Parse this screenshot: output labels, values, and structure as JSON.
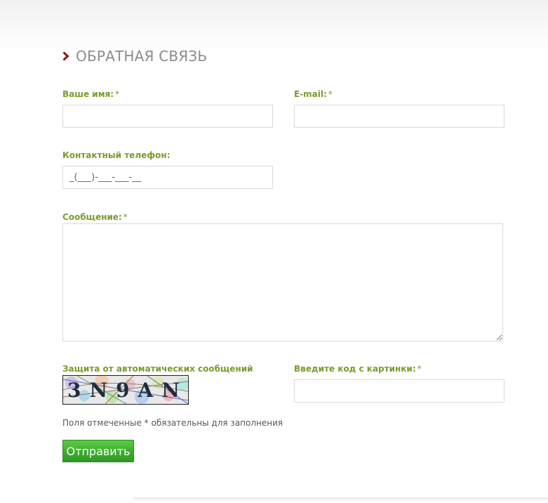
{
  "page": {
    "title": "ОБРАТНАЯ СВЯЗЬ",
    "accent_color": "#8b1a1a",
    "label_color": "#7a9b2c"
  },
  "form": {
    "name": {
      "label": "Ваше имя:",
      "required_mark": "*",
      "value": ""
    },
    "email": {
      "label": "E-mail:",
      "required_mark": "*",
      "value": ""
    },
    "phone": {
      "label": "Контактный телефон:",
      "placeholder": "_(___)-___-___-__"
    },
    "message": {
      "label": "Сообщение:",
      "required_mark": "*",
      "value": ""
    },
    "captcha": {
      "label": "Защита от автоматических сообщений",
      "image_text": "3N9AN"
    },
    "captcha_code": {
      "label": "Введите код с картинки:",
      "required_mark": "*",
      "value": ""
    },
    "required_note": "Поля отмеченные * обязательны для заполнения",
    "submit_label": "Отправить"
  }
}
